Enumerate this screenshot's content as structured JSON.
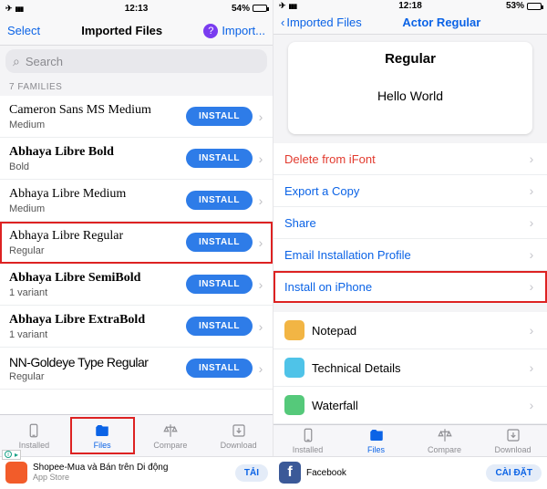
{
  "left": {
    "status": {
      "time": "12:13",
      "battery": "54%"
    },
    "nav": {
      "select": "Select",
      "title": "Imported Files",
      "import": "Import..."
    },
    "search_placeholder": "Search",
    "section": "7 FAMILIES",
    "install_label": "INSTALL",
    "fonts": [
      {
        "name": "Cameron Sans MS Medium",
        "style": "Medium",
        "class": "cursive"
      },
      {
        "name": "Abhaya Libre Bold",
        "style": "Bold",
        "class": "serif bold"
      },
      {
        "name": "Abhaya Libre Medium",
        "style": "Medium",
        "class": "serif"
      },
      {
        "name": "Abhaya Libre Regular",
        "style": "Regular",
        "class": "serif",
        "highlight": true
      },
      {
        "name": "Abhaya Libre SemiBold",
        "style": "1 variant",
        "class": "serif semi"
      },
      {
        "name": "Abhaya Libre ExtraBold",
        "style": "1 variant",
        "class": "serif bold"
      },
      {
        "name": "NN-Goldeye Type Regular",
        "style": "Regular",
        "class": "blackish"
      }
    ]
  },
  "right": {
    "status": {
      "time": "12:18",
      "battery": "53%"
    },
    "nav": {
      "back": "Imported Files",
      "title": "Actor Regular"
    },
    "preview": {
      "title": "Regular",
      "sample": "Hello World"
    },
    "actions_top": [
      {
        "label": "Delete from iFont",
        "kind": "red"
      },
      {
        "label": "Export a Copy",
        "kind": "blue"
      },
      {
        "label": "Share",
        "kind": "blue"
      },
      {
        "label": "Email Installation Profile",
        "kind": "blue"
      },
      {
        "label": "Install on iPhone",
        "kind": "blue",
        "highlight": true
      }
    ],
    "actions_bottom": [
      {
        "label": "Notepad",
        "color": "#f2b544"
      },
      {
        "label": "Technical Details",
        "color": "#4fc3e8"
      },
      {
        "label": "Waterfall",
        "color": "#55c97a"
      }
    ]
  },
  "tabs": [
    {
      "label": "Installed"
    },
    {
      "label": "Files",
      "active": true
    },
    {
      "label": "Compare"
    },
    {
      "label": "Download"
    }
  ],
  "ads": {
    "left": {
      "title": "Shopee-Mua và Bán trên Di động",
      "sub": "App Store",
      "cta": "TẢI",
      "color": "#f25c2a"
    },
    "right": {
      "title": "Facebook",
      "cta": "CÀI ĐẶT",
      "color": "#3b5998"
    }
  }
}
